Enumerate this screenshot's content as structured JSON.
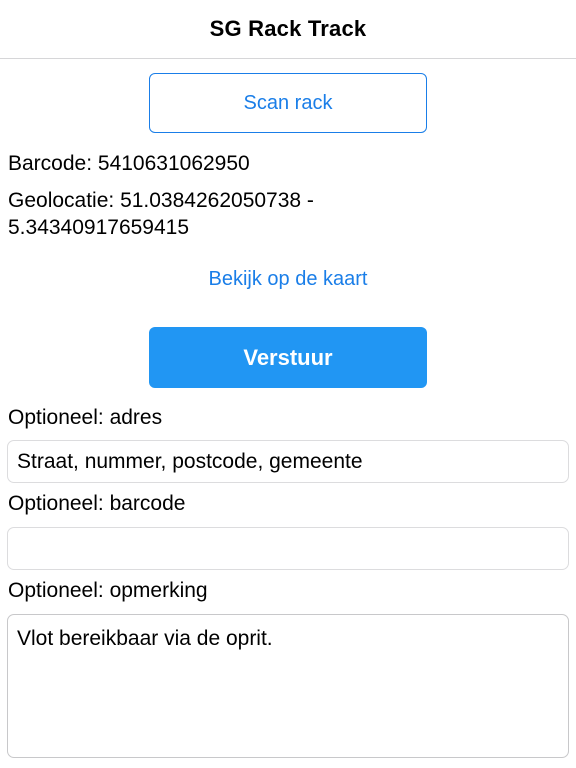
{
  "header": {
    "title": "SG Rack Track"
  },
  "scan": {
    "button_label": "Scan rack"
  },
  "info": {
    "barcode_text": "Barcode: 5410631062950",
    "geolocation_text": "Geolocatie: 51.0384262050738 - 5.34340917659415"
  },
  "map": {
    "link_label": "Bekijk op de kaart"
  },
  "send": {
    "button_label": "Verstuur"
  },
  "form": {
    "address": {
      "label": "Optioneel: adres",
      "value": "Straat, nummer, postcode, gemeente"
    },
    "barcode": {
      "label": "Optioneel: barcode",
      "value": ""
    },
    "remark": {
      "label": "Optioneel: opmerking",
      "value": "Vlot bereikbaar via de oprit."
    }
  },
  "colors": {
    "accent": "#1a7ee8",
    "primary_button": "#2196f3"
  }
}
